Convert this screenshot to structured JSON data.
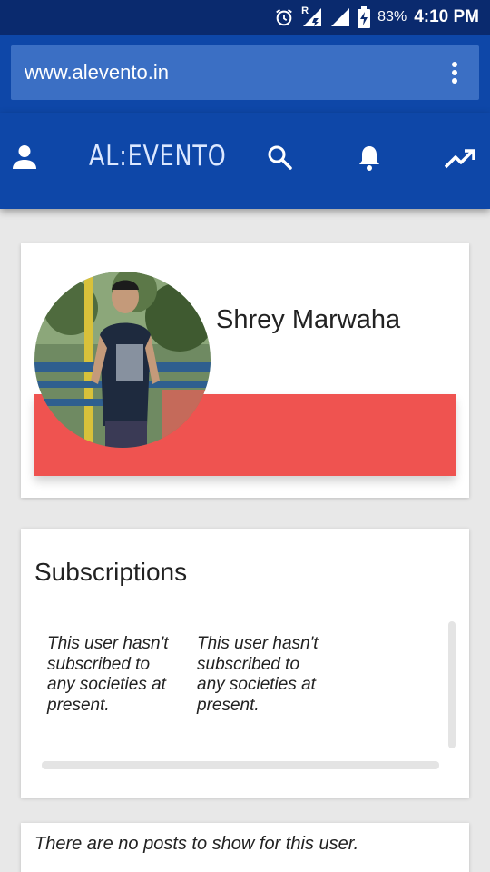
{
  "status_bar": {
    "battery": "83%",
    "time": "4:10 PM",
    "roaming_label": "R",
    "icons": [
      "alarm-icon",
      "signal-r-icon",
      "signal-icon",
      "battery-charging-icon"
    ]
  },
  "browser": {
    "url": "www.alevento.in",
    "menu_icon": "more-vert-icon"
  },
  "app_bar": {
    "brand": "AL:EVENTO",
    "icons": [
      "person-icon",
      "search-icon",
      "bell-icon",
      "trending-icon"
    ]
  },
  "profile": {
    "name": "Shrey Marwaha",
    "avatar": "profile-photo",
    "accent_color": "#ef5350"
  },
  "subscriptions": {
    "title": "Subscriptions",
    "items": [
      {
        "text": "This user hasn't subscribed to any societies at present."
      },
      {
        "text": "This user hasn't subscribed to any societies at present."
      }
    ]
  },
  "posts": {
    "empty_text": "There are no posts to show for this user."
  },
  "colors": {
    "status_bar": "#0a2a6e",
    "primary": "#0e47a8",
    "url_field": "#3b6fc4",
    "background": "#e8e8e8"
  }
}
